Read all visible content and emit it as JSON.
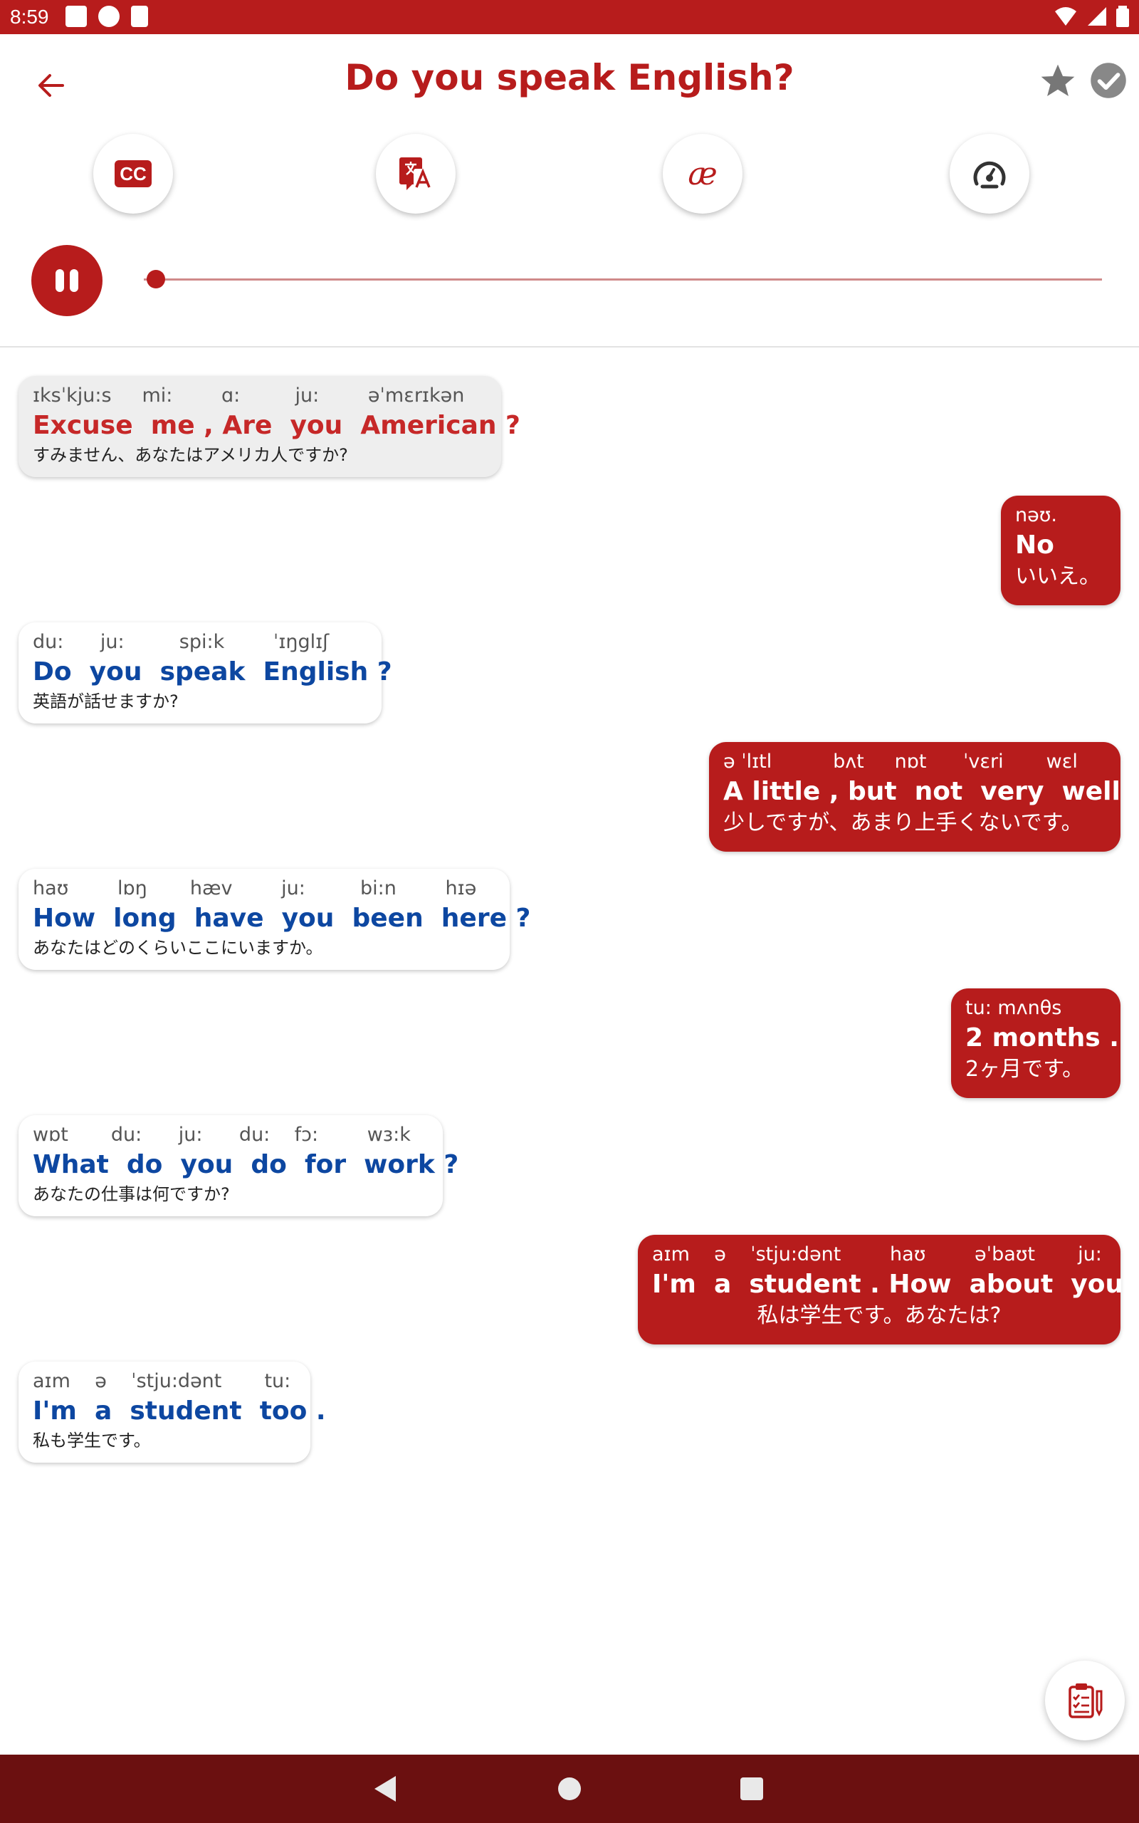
{
  "status_bar": {
    "time": "8:59"
  },
  "header": {
    "title": "Do you speak English?"
  },
  "toolbar": {
    "cc_label": "CC",
    "ipa_symbol": "æ",
    "translate_icon": "translate-icon",
    "speed_icon": "speedometer-icon"
  },
  "player": {
    "state": "playing",
    "progress": 0.0
  },
  "colors": {
    "brand": "#b71c1c",
    "english_blue": "#0d47a1",
    "nav": "#6b1010"
  },
  "messages": [
    {
      "side": "left",
      "ipa": "ɪksˈkju:s     mi:        ɑ:         ju:        əˈmɛrɪkən",
      "en": "Excuse  me , Are  you  American ?",
      "ja": "すみません、あなたはアメリカ人ですか?"
    },
    {
      "side": "right",
      "ipa": "nəʊ.",
      "en": "No",
      "ja": "いいえ。"
    },
    {
      "side": "left",
      "ipa": "du:      ju:         spi:k        ˈɪŋglɪʃ",
      "en": "Do  you  speak  English ?",
      "ja": "英語が話せますか?"
    },
    {
      "side": "right",
      "ipa": "ə ˈlɪtl          bʌt     nɒt      ˈvɛri       wɛl",
      "en": "A little , but  not  very  well .",
      "ja": "少しですが、あまり上手くないです。"
    },
    {
      "side": "left",
      "ipa": "haʊ        lɒŋ       hæv        ju:         bi:n        hɪə",
      "en": "How  long  have  you  been  here ?",
      "ja": "あなたはどのくらいここにいますか。"
    },
    {
      "side": "right",
      "ipa": "tu: mʌnθs",
      "en": "2 months .",
      "ja": "2ヶ月です。"
    },
    {
      "side": "left",
      "ipa": "wɒt       du:      ju:      du:    fɔ:        wɜ:k",
      "en": "What  do  you  do  for  work ?",
      "ja": "あなたの仕事は何ですか?"
    },
    {
      "side": "right",
      "ipa": "aɪm    ə    ˈstju:dənt        haʊ        əˈbaʊt       ju:",
      "en": "I'm  a  student . How  about  you ?",
      "ja": "私は学生です。あなたは?"
    },
    {
      "side": "left",
      "ipa": "aɪm    ə    ˈstju:dənt       tu:",
      "en": "I'm  a  student  too .",
      "ja": "私も学生です。"
    }
  ],
  "fab": {
    "icon": "quiz-clipboard-icon"
  },
  "nav": {
    "back": "nav-back-icon",
    "home": "nav-home-icon",
    "recent": "nav-recent-icon"
  }
}
